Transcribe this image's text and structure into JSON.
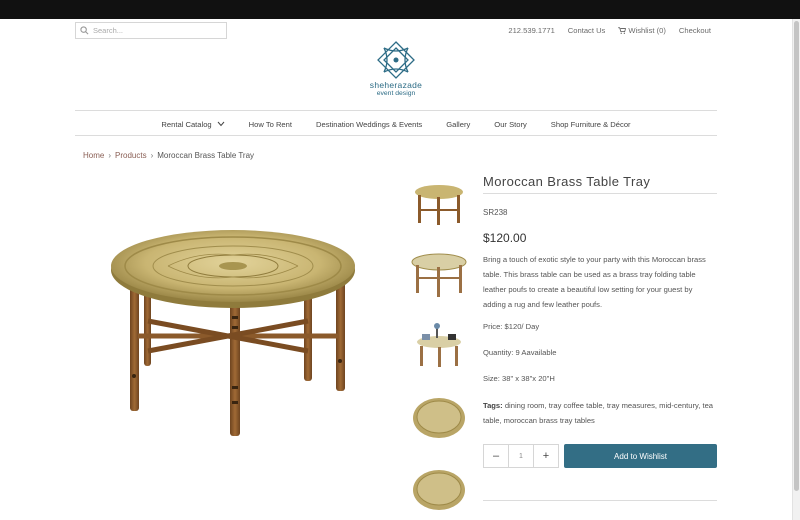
{
  "search": {
    "placeholder": "Search..."
  },
  "top_links": {
    "phone": "212.539.1771",
    "contact": "Contact Us",
    "wishlist": "Wishlist (0)",
    "checkout": "Checkout"
  },
  "logo": {
    "line1": "sheherazade",
    "line2": "event design"
  },
  "nav": {
    "items": [
      "Rental Catalog",
      "How To Rent",
      "Destination Weddings & Events",
      "Gallery",
      "Our Story",
      "Shop Furniture & Décor"
    ]
  },
  "breadcrumb": {
    "home": "Home",
    "products": "Products",
    "current": "Moroccan Brass Table Tray"
  },
  "product": {
    "title": "Moroccan Brass Table Tray",
    "sku": "SR238",
    "price": "$120.00",
    "description": "Bring a touch of exotic style to your party with this Moroccan brass table. This brass table can be used as a  brass tray folding table leather poufs to create a beautiful low setting for your guest by adding a rug and few leather poufs.",
    "price_line": " Price: $120/ Day",
    "quantity_line": "Quantity: 9 Aavailable",
    "size_line": "Size: 38\" x 38\"x 20\"H",
    "tags_label": "Tags:",
    "tags_text": " dining room, tray coffee table, tray measures,  mid-century,  tea table,  moroccan brass tray tables"
  },
  "quantity": {
    "minus": "–",
    "value": "1",
    "plus": "+"
  },
  "wishlist_button": "Add to Wishlist",
  "colors": {
    "accent": "#336e85",
    "breadcrumb_link": "#8a5f55",
    "brass": "#c9b572",
    "wood": "#8b5a2b"
  }
}
